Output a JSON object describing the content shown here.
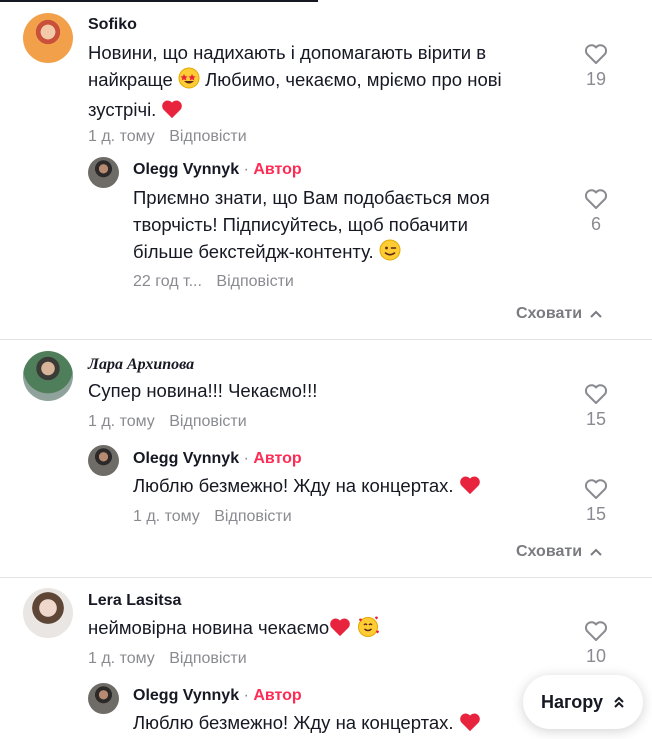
{
  "comments": [
    {
      "author": "Sofiko",
      "text_lines": [
        "Новини, що надихають і допомагають вірити в",
        "найкраще",
        "Любимо, чекаємо, мріємо про нові",
        "зустрічі."
      ],
      "emoji": [
        "star-struck-emoji",
        "heart-emoji"
      ],
      "time": "1 д. тому",
      "reply_label": "Відповісти",
      "likes": "19",
      "reply": {
        "author": "Olegg Vynnyk",
        "separator": "·",
        "author_badge": "Автор",
        "text_lines": [
          "Приємно знати, що Вам подобається моя",
          "творчість! Підписуйтесь, щоб побачити",
          "більше бекстейдж-контенту."
        ],
        "emoji": [
          "winking-emoji"
        ],
        "time": "22 год т...",
        "reply_label": "Відповісти",
        "likes": "6"
      },
      "hide_label": "Сховати"
    },
    {
      "author": "Лара Архипова",
      "text_lines": [
        "Супер новина!!! Чекаємо!!!"
      ],
      "time": "1 д. тому",
      "reply_label": "Відповісти",
      "likes": "15",
      "reply": {
        "author": "Olegg Vynnyk",
        "separator": "·",
        "author_badge": "Автор",
        "text_lines": [
          "Люблю безмежно! Жду на концертах."
        ],
        "emoji": [
          "heart-emoji"
        ],
        "time": "1 д. тому",
        "reply_label": "Відповісти",
        "likes": "15"
      },
      "hide_label": "Сховати"
    },
    {
      "author": "Lera Lasitsa",
      "text_lines": [
        "неймовірна новина чекаємо"
      ],
      "emoji": [
        "heart-emoji",
        "smiling-hearts-emoji"
      ],
      "time": "1 д. тому",
      "reply_label": "Відповісти",
      "likes": "10",
      "reply": {
        "author": "Olegg Vynnyk",
        "separator": "·",
        "author_badge": "Автор",
        "text_lines": [
          "Люблю безмежно! Жду на концертах."
        ],
        "emoji": [
          "heart-emoji"
        ]
      }
    }
  ],
  "scroll_top_label": "Нагору",
  "colors": {
    "author_badge": "#fe2c55",
    "heart": "#fe2c55",
    "muted": "#8a8b91",
    "text": "#161823"
  }
}
